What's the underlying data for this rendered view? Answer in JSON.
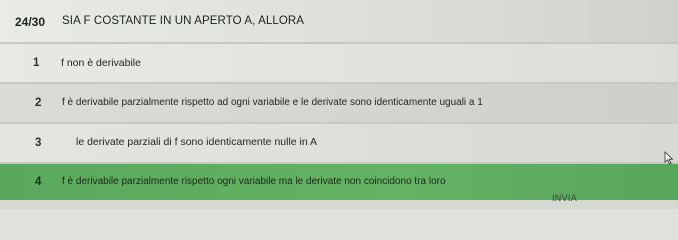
{
  "quiz": {
    "counter": "24/30",
    "question": "SIA F COSTANTE IN UN APERTO A, ALLORA",
    "options": [
      {
        "number": "1",
        "text": "f non è derivabile"
      },
      {
        "number": "2",
        "text": "f è derivabile parzialmente rispetto ad ogni variabile e le derivate sono identicamente uguali a 1"
      },
      {
        "number": "3",
        "text": "le derivate parziali di f sono identicamente nulle in A"
      },
      {
        "number": "4",
        "text": "f è derivabile parzialmente rispetto ogni variabile ma le derivate non coincidono tra loro"
      }
    ],
    "selected_option": "4",
    "submit_label": "INVIA"
  },
  "colors": {
    "selected_bg": "#5eab5f",
    "row_bg": "#e0e2dc"
  },
  "icons": {
    "cursor": "mouse-pointer-icon"
  }
}
